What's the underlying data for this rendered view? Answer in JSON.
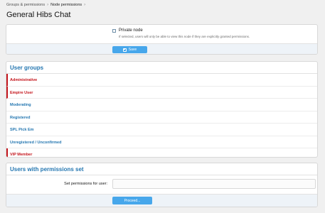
{
  "breadcrumb": {
    "items": [
      "Groups & permissions",
      "Node permissions"
    ]
  },
  "page": {
    "title": "General Hibs Chat"
  },
  "private_node": {
    "label": "Private node",
    "hint": "If selected, users will only be able to view this node if they are explicitly granted permissions.",
    "checked": false
  },
  "save_button": {
    "label": "Save"
  },
  "user_groups": {
    "title": "User groups",
    "items": [
      {
        "label": "Administrative",
        "has_permissions": true
      },
      {
        "label": "Empire User",
        "has_permissions": true
      },
      {
        "label": "Moderating",
        "has_permissions": false
      },
      {
        "label": "Registered",
        "has_permissions": false
      },
      {
        "label": "SPL Pick Em",
        "has_permissions": false
      },
      {
        "label": "Unregistered / Unconfirmed",
        "has_permissions": false
      },
      {
        "label": "VIP Member",
        "has_permissions": true
      }
    ]
  },
  "users_permissions": {
    "title": "Users with permissions set",
    "field_label": "Set permissions for user:",
    "input_value": "",
    "proceed_label": "Proceed..."
  },
  "colors": {
    "accent": "#47a7eb",
    "link": "#2577b1",
    "set_permission": "#c4151c"
  }
}
